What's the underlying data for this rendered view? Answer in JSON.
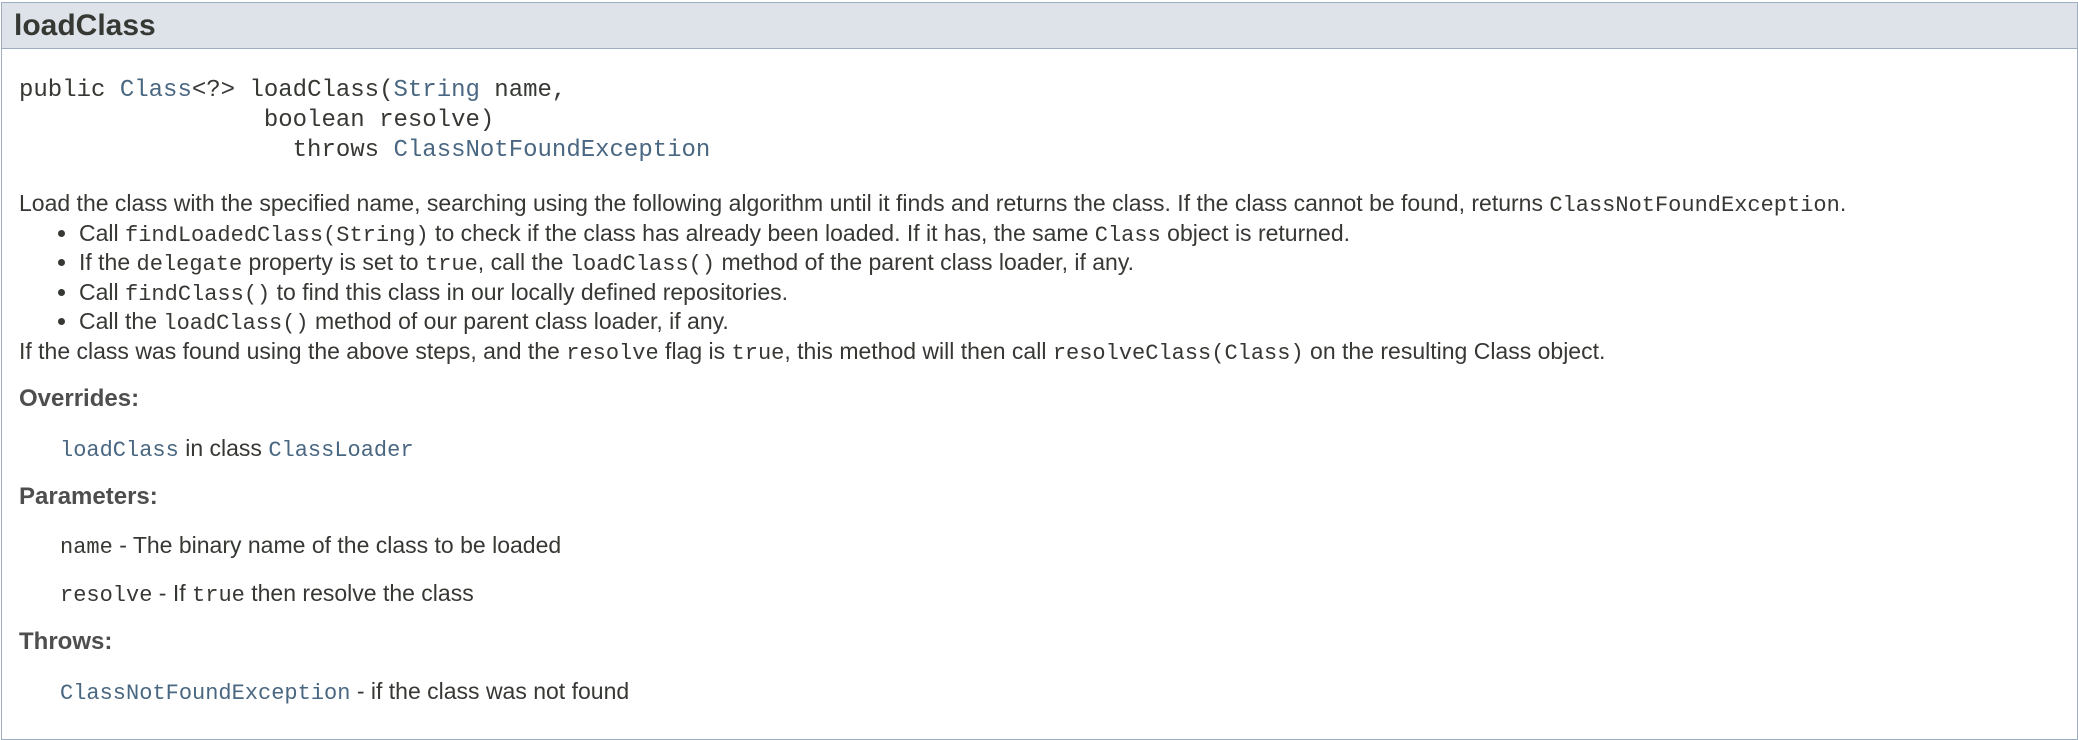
{
  "method_name": "loadClass",
  "signature": {
    "modifiers": "public ",
    "return_type": "Class",
    "return_generic": "<?> ",
    "name": "loadClass",
    "open_paren": "(",
    "param1_type": "String",
    "param1_name": " name,",
    "line2": "boolean resolve)",
    "throws_kw": "throws ",
    "throws_type": "ClassNotFoundException"
  },
  "description": {
    "intro_text": "Load the class with the specified name, searching using the following algorithm until it finds and returns the class. If the class cannot be found, returns ",
    "intro_code": "ClassNotFoundException",
    "intro_end": ".",
    "steps": [
      {
        "t1": "Call ",
        "c1": "findLoadedClass(String)",
        "t2": " to check if the class has already been loaded. If it has, the same ",
        "c2": "Class",
        "t3": " object is returned."
      },
      {
        "t1": "If the ",
        "c1": "delegate",
        "t2": " property is set to ",
        "c2": "true",
        "t3": ", call the ",
        "c3": "loadClass()",
        "t4": " method of the parent class loader, if any."
      },
      {
        "t1": "Call ",
        "c1": "findClass()",
        "t2": " to find this class in our locally defined repositories."
      },
      {
        "t1": "Call the ",
        "c1": "loadClass()",
        "t2": " method of our parent class loader, if any."
      }
    ],
    "outro": {
      "t1": "If the class was found using the above steps, and the ",
      "c1": "resolve",
      "t2": " flag is ",
      "c2": "true",
      "t3": ", this method will then call ",
      "c3": "resolveClass(Class)",
      "t4": " on the resulting Class object."
    }
  },
  "overrides": {
    "label": "Overrides:",
    "method_link": "loadClass",
    "in_class": " in class ",
    "class_link": "ClassLoader"
  },
  "parameters": {
    "label": "Parameters:",
    "items": [
      {
        "name": "name",
        "desc": " - The binary name of the class to be loaded"
      },
      {
        "name": "resolve",
        "desc_a": " - If ",
        "desc_code": "true",
        "desc_b": " then resolve the class"
      }
    ]
  },
  "throws": {
    "label": "Throws:",
    "exception": "ClassNotFoundException",
    "desc": " - if the class was not found"
  },
  "colors": {
    "header_bg": "#dee3e9",
    "border": "#9eadc0",
    "link": "#4a6782",
    "text": "#353833"
  }
}
